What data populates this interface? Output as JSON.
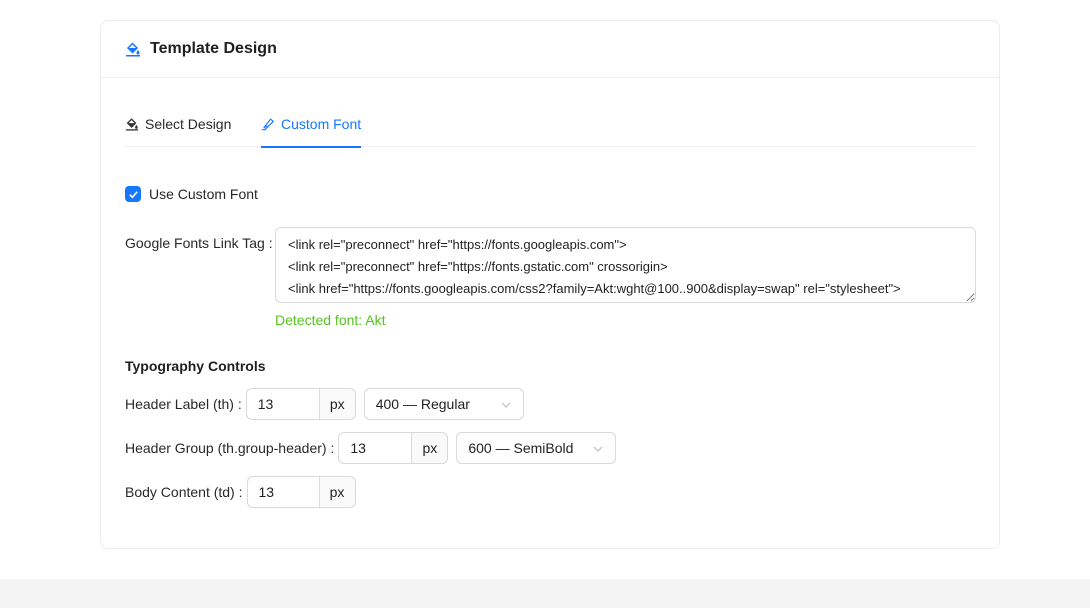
{
  "card": {
    "title": "Template Design",
    "header_icon": "paint-bucket-icon"
  },
  "tabs": [
    {
      "label": "Select Design",
      "icon": "paint-bucket-icon",
      "active": false
    },
    {
      "label": "Custom Font",
      "icon": "highlighter-icon",
      "active": true
    }
  ],
  "custom_font": {
    "checkbox_label": "Use Custom Font",
    "checked": true,
    "link_tag_label": "Google Fonts Link Tag",
    "link_tag_value": "<link rel=\"preconnect\" href=\"https://fonts.googleapis.com\">\n<link rel=\"preconnect\" href=\"https://fonts.gstatic.com\" crossorigin>\n<link href=\"https://fonts.googleapis.com/css2?family=Akt:wght@100..900&display=swap\" rel=\"stylesheet\">",
    "detected_text": "Detected font: Akt"
  },
  "typography": {
    "title": "Typography Controls",
    "unit": "px",
    "rows": [
      {
        "label": "Header Label (th)",
        "size": "13",
        "weight": "400 — Regular"
      },
      {
        "label": "Header Group (th.group-header)",
        "size": "13",
        "weight": "600 — SemiBold"
      },
      {
        "label": "Body Content (td)",
        "size": "13"
      }
    ]
  },
  "colors": {
    "primary": "#1677ff",
    "success": "#52c41a",
    "border": "#d9d9d9"
  }
}
